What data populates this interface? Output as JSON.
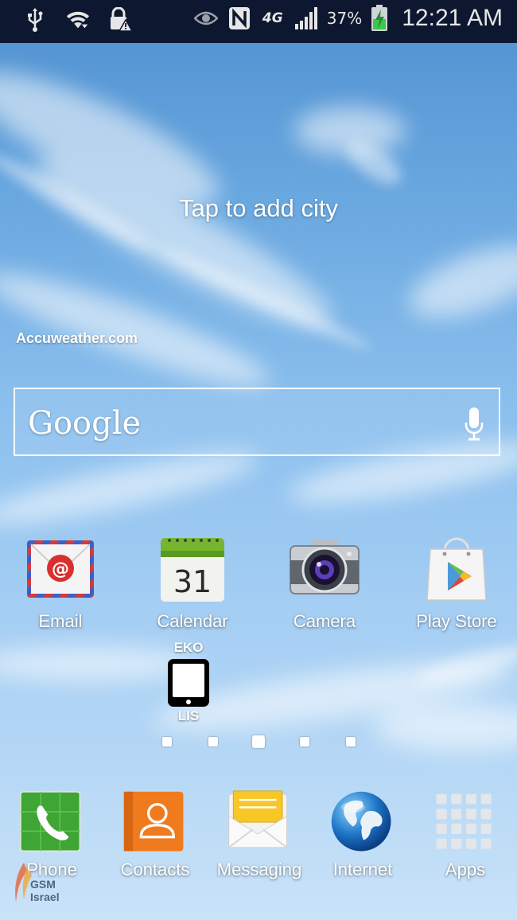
{
  "statusbar": {
    "left_icons": [
      "usb-icon",
      "wifi-icon",
      "lock-warning-icon"
    ],
    "right_icons": [
      "eye-icon",
      "nfc-icon",
      "network-4g-icon",
      "signal-icon",
      "battery-charging-icon"
    ],
    "network_type": "4G",
    "battery_percent": "37%",
    "time": "12:21 AM"
  },
  "weather": {
    "city_prompt": "Tap to add city",
    "brand": "Accuweather.com"
  },
  "search": {
    "logo": "Google",
    "mic_icon": "microphone-icon"
  },
  "home_apps": [
    {
      "label": "Email",
      "icon": "email-icon"
    },
    {
      "label": "Calendar",
      "icon": "calendar-icon",
      "day": "31"
    },
    {
      "label": "Camera",
      "icon": "camera-icon"
    },
    {
      "label": "Play Store",
      "icon": "play-store-icon"
    }
  ],
  "eko_widget": {
    "top": "EKO",
    "bottom": "LIS",
    "icon": "tablet-icon"
  },
  "page_indicator": {
    "count": 5,
    "active_index": 2
  },
  "dock": [
    {
      "label": "Phone",
      "icon": "phone-icon"
    },
    {
      "label": "Contacts",
      "icon": "contacts-icon"
    },
    {
      "label": "Messaging",
      "icon": "messaging-icon"
    },
    {
      "label": "Internet",
      "icon": "globe-icon"
    },
    {
      "label": "Apps",
      "icon": "apps-grid-icon"
    }
  ],
  "watermark": {
    "line1": "GSM",
    "line2": "Israel"
  },
  "colors": {
    "statusbar": "#0d1830",
    "sky_top": "#4f90d0",
    "sky_bottom": "#c9e2f8"
  }
}
